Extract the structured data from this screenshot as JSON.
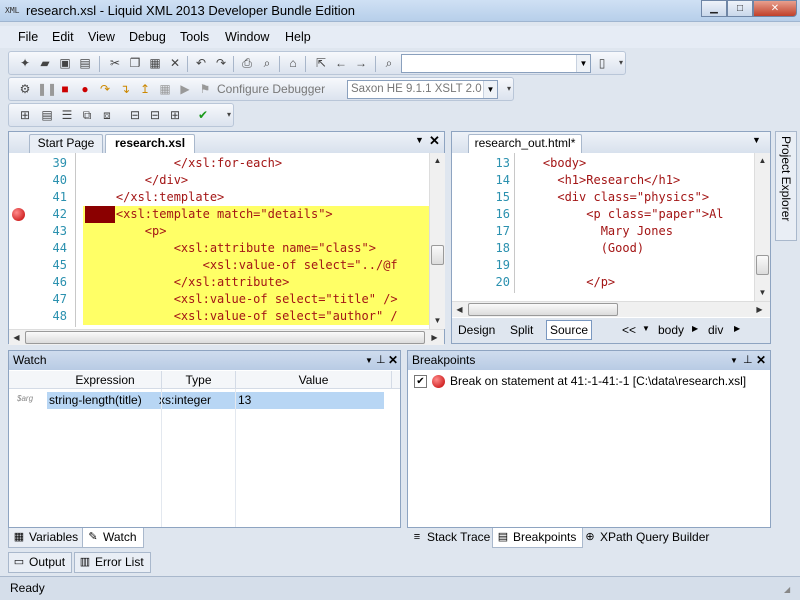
{
  "window": {
    "app_icon": "XML",
    "title": "research.xsl - Liquid XML 2013 Developer Bundle Edition",
    "minimize_glyph": "▁",
    "maximize_glyph": "□",
    "close_glyph": "✕"
  },
  "menu": [
    "File",
    "Edit",
    "View",
    "Debug",
    "Tools",
    "Window",
    "Help"
  ],
  "toolbar": {
    "configure_debugger_label": "Configure Debugger",
    "xslt_engine_value": "Saxon HE 9.1.1 XSLT 2.0 Er",
    "search_combo_value": ""
  },
  "editor_left": {
    "tabs": [
      "Start Page",
      "research.xsl"
    ],
    "active_tab": "research.xsl",
    "lines": [
      {
        "no": "39",
        "indent": 12,
        "text": "</xsl:for-each>",
        "highlight": false
      },
      {
        "no": "40",
        "indent": 8,
        "text": "</div>",
        "highlight": false
      },
      {
        "no": "41",
        "indent": 4,
        "text": "</xsl:template>",
        "highlight": false
      },
      {
        "no": "42",
        "indent": 4,
        "text": "<xsl:template match=\"details\">",
        "highlight": true
      },
      {
        "no": "43",
        "indent": 8,
        "text": "<p>",
        "highlight": true
      },
      {
        "no": "44",
        "indent": 12,
        "text": "<xsl:attribute name=\"class\">",
        "highlight": true
      },
      {
        "no": "45",
        "indent": 16,
        "text": "<xsl:value-of select=\"../@f",
        "highlight": true
      },
      {
        "no": "46",
        "indent": 12,
        "text": "</xsl:attribute>",
        "highlight": true
      },
      {
        "no": "47",
        "indent": 12,
        "text": "<xsl:value-of select=\"title\" />",
        "highlight": true
      },
      {
        "no": "48",
        "indent": 12,
        "text": "<xsl:value-of select=\"author\" /",
        "highlight": true
      }
    ]
  },
  "editor_right": {
    "tab": "research_out.html*",
    "lines": [
      {
        "no": "13",
        "indent": 4,
        "text": "<body>"
      },
      {
        "no": "14",
        "indent": 6,
        "text": "<h1>Research</h1>"
      },
      {
        "no": "15",
        "indent": 6,
        "text": "<div class=\"physics\">"
      },
      {
        "no": "16",
        "indent": 10,
        "text": "<p class=\"paper\">Al"
      },
      {
        "no": "17",
        "indent": 12,
        "text": "Mary Jones"
      },
      {
        "no": "18",
        "indent": 12,
        "text": "(Good)"
      },
      {
        "no": "19",
        "indent": 0,
        "text": ""
      },
      {
        "no": "20",
        "indent": 10,
        "text": "</p>"
      }
    ],
    "view_tabs": [
      "Design",
      "Split",
      "Source"
    ],
    "active_view": "Source",
    "breadcrumb": [
      "<<",
      "body",
      "div"
    ]
  },
  "project_explorer_label": "Project Explorer",
  "watch": {
    "title": "Watch",
    "columns": [
      "Expression",
      "Type",
      "Value"
    ],
    "rows": [
      {
        "expression": "string-length(title)",
        "type": "xs:integer",
        "value": "13",
        "tag": "$arg"
      }
    ]
  },
  "breakpoints": {
    "title": "Breakpoints",
    "items": [
      {
        "checked": true,
        "label": "Break on statement at 41:-1-41:-1 [C:\\data\\research.xsl]"
      }
    ]
  },
  "bottom_tabs_left": [
    "Variables",
    "Watch"
  ],
  "bottom_tabs_left_active": "Watch",
  "bottom_tabs_right": [
    "Stack Trace",
    "Breakpoints",
    "XPath Query Builder"
  ],
  "bottom_tabs_right_active": "Breakpoints",
  "output_tabs": [
    "Output",
    "Error List"
  ],
  "status": "Ready"
}
